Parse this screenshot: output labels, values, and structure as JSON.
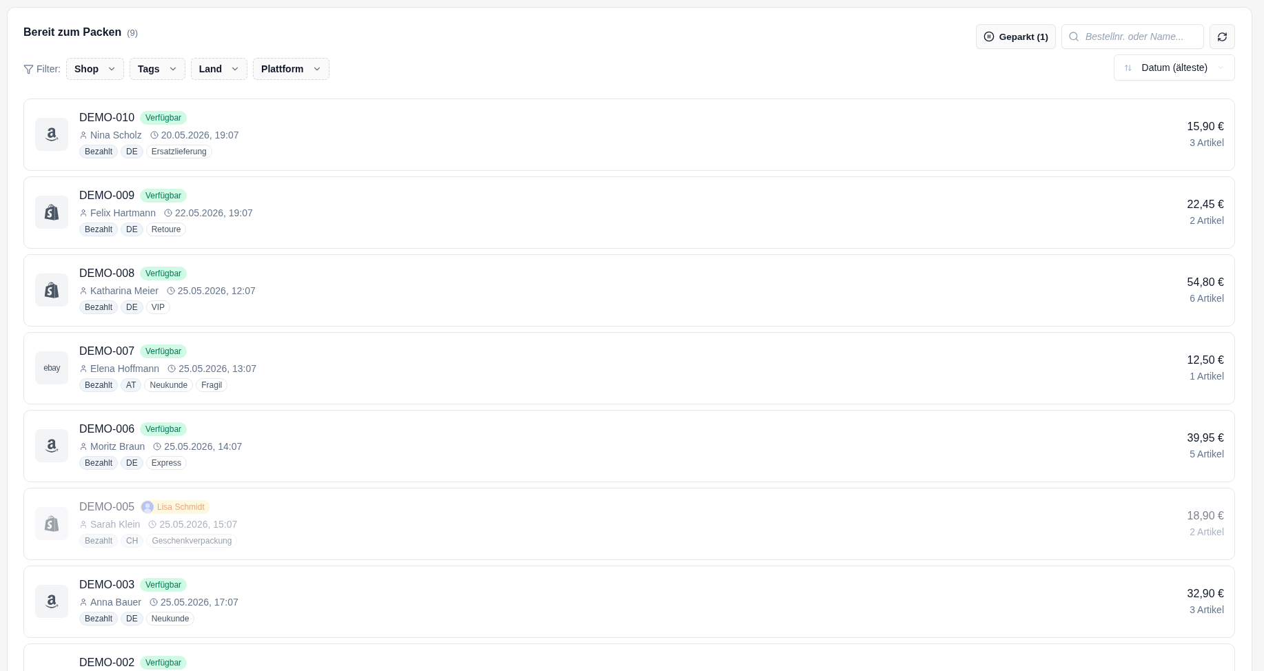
{
  "header": {
    "title": "Bereit zum Packen",
    "count": "(9)"
  },
  "filter": {
    "label": "Filter:",
    "chips": [
      "Shop",
      "Tags",
      "Land",
      "Plattform"
    ]
  },
  "actions": {
    "parked_button": "Geparkt (1)",
    "search": {
      "placeholder": "Bestellnr. oder Name..."
    },
    "sort": "Datum (älteste)"
  },
  "orders": [
    {
      "id": "DEMO-010",
      "logo": {
        "kind": "amazon"
      },
      "status": {
        "kind": "available",
        "label": "Verfügbar"
      },
      "customer": "Nina Scholz",
      "date": "20.05.2026, 19:07",
      "tags": [
        {
          "kind": "filled",
          "label": "Bezahlt"
        },
        {
          "kind": "filled",
          "label": "DE"
        },
        {
          "kind": "outline",
          "label": "Ersatzlieferung"
        }
      ],
      "total": "15,90 €",
      "items": "3 Artikel"
    },
    {
      "id": "DEMO-009",
      "logo": {
        "kind": "shopify"
      },
      "status": {
        "kind": "available",
        "label": "Verfügbar"
      },
      "customer": "Felix Hartmann",
      "date": "22.05.2026, 19:07",
      "tags": [
        {
          "kind": "filled",
          "label": "Bezahlt"
        },
        {
          "kind": "filled",
          "label": "DE"
        },
        {
          "kind": "outline",
          "label": "Retoure"
        }
      ],
      "total": "22,45 €",
      "items": "2 Artikel"
    },
    {
      "id": "DEMO-008",
      "logo": {
        "kind": "shopify"
      },
      "status": {
        "kind": "available",
        "label": "Verfügbar"
      },
      "customer": "Katharina Meier",
      "date": "25.05.2026, 12:07",
      "tags": [
        {
          "kind": "filled",
          "label": "Bezahlt"
        },
        {
          "kind": "filled",
          "label": "DE"
        },
        {
          "kind": "outline",
          "label": "VIP"
        }
      ],
      "total": "54,80 €",
      "items": "6 Artikel"
    },
    {
      "id": "DEMO-007",
      "logo": {
        "kind": "wordmark",
        "text": "ebay"
      },
      "status": {
        "kind": "available",
        "label": "Verfügbar"
      },
      "customer": "Elena Hoffmann",
      "date": "25.05.2026, 13:07",
      "tags": [
        {
          "kind": "filled",
          "label": "Bezahlt"
        },
        {
          "kind": "filled",
          "label": "AT"
        },
        {
          "kind": "outline",
          "label": "Neukunde"
        },
        {
          "kind": "outline",
          "label": "Fragil"
        }
      ],
      "total": "12,50 €",
      "items": "1 Artikel"
    },
    {
      "id": "DEMO-006",
      "logo": {
        "kind": "amazon"
      },
      "status": {
        "kind": "available",
        "label": "Verfügbar"
      },
      "customer": "Moritz Braun",
      "date": "25.05.2026, 14:07",
      "tags": [
        {
          "kind": "filled",
          "label": "Bezahlt"
        },
        {
          "kind": "filled",
          "label": "DE"
        },
        {
          "kind": "outline",
          "label": "Express"
        }
      ],
      "total": "39,95 €",
      "items": "5 Artikel"
    },
    {
      "id": "DEMO-005",
      "logo": {
        "kind": "shopify"
      },
      "status": {
        "kind": "claimed",
        "label": "Lisa Schmidt"
      },
      "customer": "Sarah Klein",
      "date": "25.05.2026, 15:07",
      "tags": [
        {
          "kind": "filled",
          "label": "Bezahlt"
        },
        {
          "kind": "filled",
          "label": "CH"
        },
        {
          "kind": "outline",
          "label": "Geschenkverpackung"
        }
      ],
      "total": "18,90 €",
      "items": "2 Artikel"
    },
    {
      "id": "DEMO-003",
      "logo": {
        "kind": "amazon"
      },
      "status": {
        "kind": "available",
        "label": "Verfügbar"
      },
      "customer": "Anna Bauer",
      "date": "25.05.2026, 17:07",
      "tags": [
        {
          "kind": "filled",
          "label": "Bezahlt"
        },
        {
          "kind": "filled",
          "label": "DE"
        },
        {
          "kind": "outline",
          "label": "Neukunde"
        }
      ],
      "total": "32,90 €",
      "items": "3 Artikel"
    },
    {
      "id": "DEMO-002",
      "status": {
        "kind": "available",
        "label": "Verfügbar"
      }
    }
  ]
}
